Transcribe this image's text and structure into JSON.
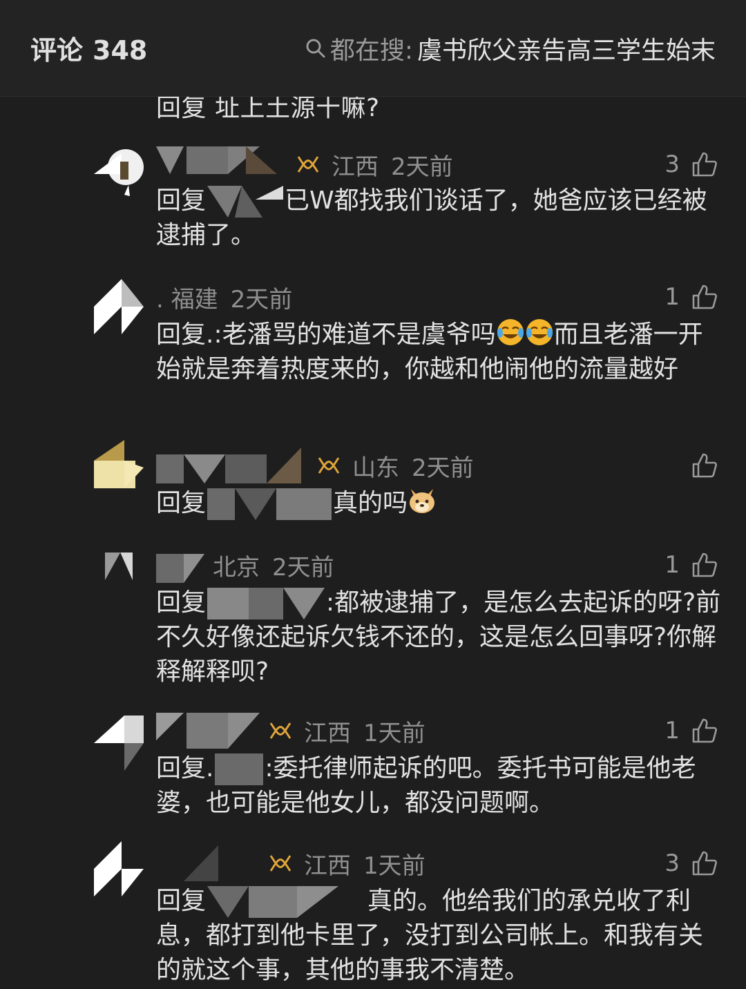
{
  "header": {
    "title": "评论",
    "count": "348",
    "search_label": "都在搜:",
    "search_query": "虞书欣父亲告高三学生始末"
  },
  "partial_reply": "回复 址上土源十嘛?",
  "comments": [
    {
      "region": "江西",
      "time": "2天前",
      "likes": "3",
      "pre": "回复",
      "post": "已W都找我们谈话了，她爸应该已经被逮捕了。"
    },
    {
      "region": ". 福建",
      "time": "2天前",
      "likes": "1",
      "pre": "回复.:老潘骂的难道不是虞爷吗",
      "post": "而且老潘一开始就是奔着热度来的，你越和他闹他的流量越好"
    },
    {
      "region": "山东",
      "time": "2天前",
      "likes": "",
      "pre": "回复",
      "post": "真的吗"
    },
    {
      "region": "北京",
      "time": "2天前",
      "likes": "1",
      "pre": "回复",
      "post": ":都被逮捕了，是怎么去起诉的呀?前不久好像还起诉欠钱不还的，这是怎么回事呀?你解释解释呗?"
    },
    {
      "region": "江西",
      "time": "1天前",
      "likes": "1",
      "pre": "回复.",
      "post": ":委托律师起诉的吧。委托书可能是他老婆，也可能是他女儿，都没问题啊。"
    },
    {
      "region": "江西",
      "time": "1天前",
      "likes": "3",
      "pre": "回复",
      "post": "真的。他给我们的承兑收了利息，都打到他卡里了，没打到公司帐上。和我有关的就这个事，其他的事我不清楚。"
    }
  ],
  "colors": {
    "background": "#1e1e1e",
    "header": "#232323",
    "text": "#e2e2e2",
    "meta": "#8f8f8f",
    "vip": "#e0a53a"
  }
}
